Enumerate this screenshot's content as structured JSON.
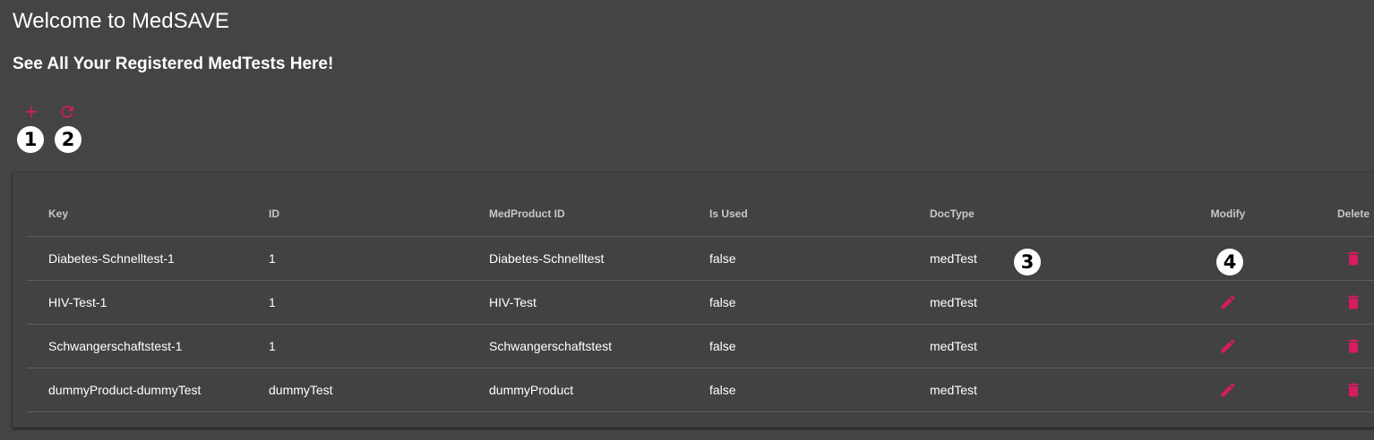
{
  "header": {
    "title": "Welcome to MedSAVE",
    "subtitle": "See All Your Registered MedTests Here!"
  },
  "toolbar": {
    "add_icon": "plus-icon",
    "refresh_icon": "refresh-icon"
  },
  "callouts": [
    "1",
    "2",
    "3",
    "4"
  ],
  "table": {
    "columns": [
      "Key",
      "ID",
      "MedProduct ID",
      "Is Used",
      "DocType",
      "Modify",
      "Delete"
    ],
    "rows": [
      {
        "key": "Diabetes-Schnelltest-1",
        "id": "1",
        "medproduct_id": "Diabetes-Schnelltest",
        "is_used": "false",
        "doctype": "medTest"
      },
      {
        "key": "HIV-Test-1",
        "id": "1",
        "medproduct_id": "HIV-Test",
        "is_used": "false",
        "doctype": "medTest"
      },
      {
        "key": "Schwangerschaftstest-1",
        "id": "1",
        "medproduct_id": "Schwangerschaftstest",
        "is_used": "false",
        "doctype": "medTest"
      },
      {
        "key": "dummyProduct-dummyTest",
        "id": "dummyTest",
        "medproduct_id": "dummyProduct",
        "is_used": "false",
        "doctype": "medTest"
      }
    ],
    "modify_icon": "pencil-icon",
    "delete_icon": "trash-icon"
  },
  "colors": {
    "background": "#444444",
    "accent": "#d81b60",
    "text": "#ffffff",
    "header_text": "#c8c8c8",
    "divider": "#5e5e5e"
  }
}
